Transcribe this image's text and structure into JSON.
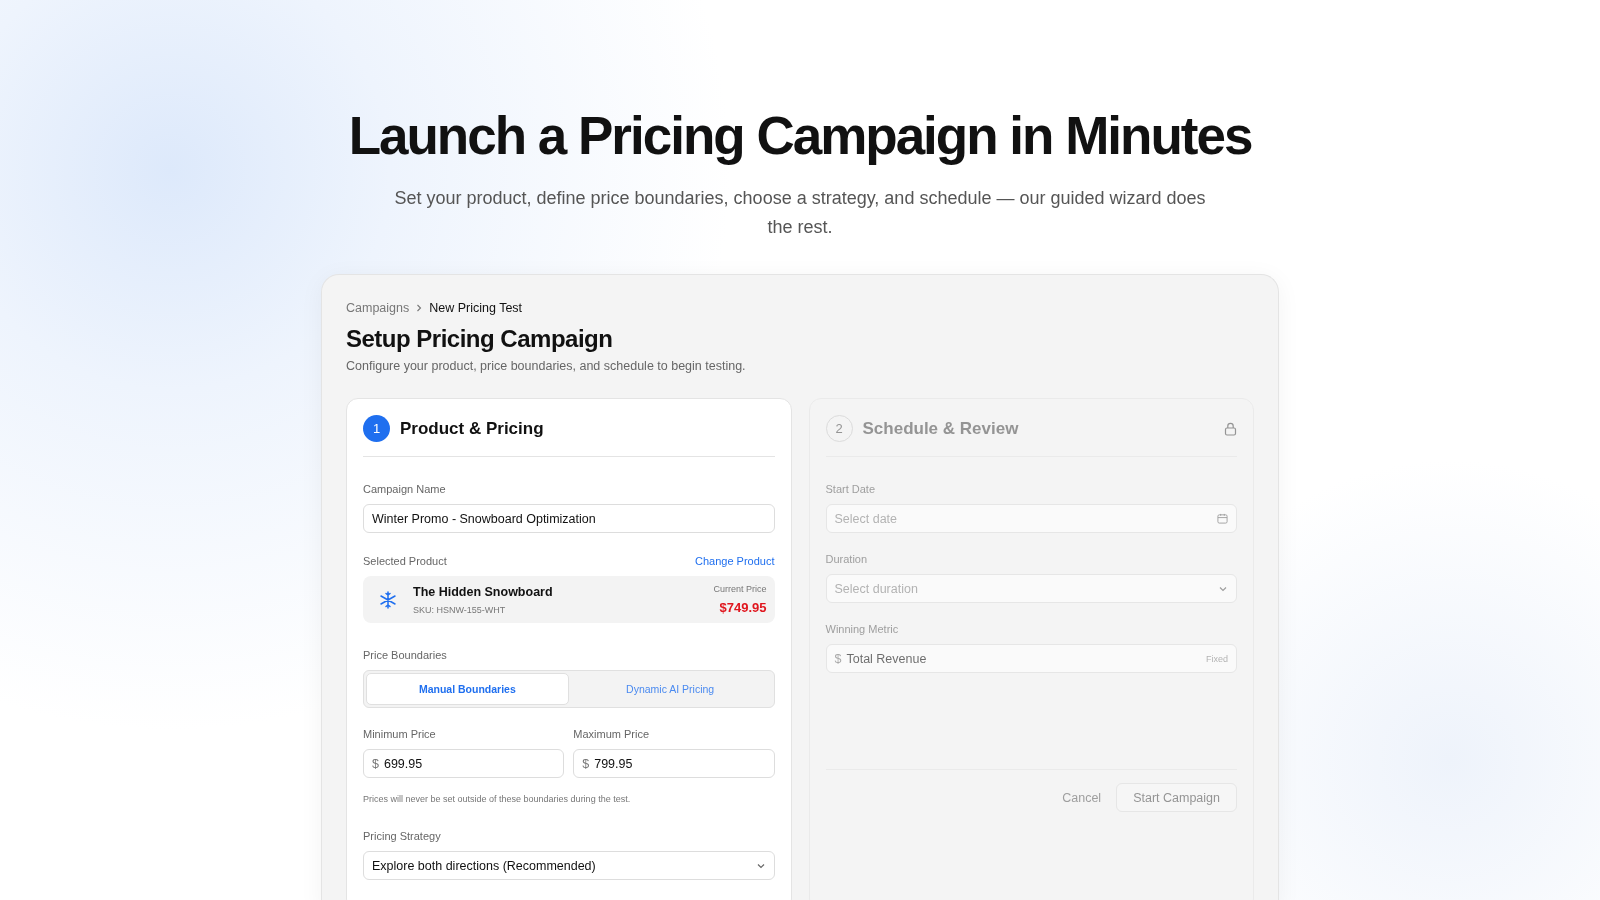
{
  "hero": {
    "title": "Launch a Pricing Campaign in Minutes",
    "subtitle": "Set your product, define price boundaries, choose a strategy, and schedule — our guided wizard does the rest."
  },
  "breadcrumb": [
    {
      "label": "Campaigns",
      "current": false
    },
    {
      "label": "New Pricing Test",
      "current": true
    }
  ],
  "page": {
    "title": "Setup Pricing Campaign",
    "description": "Configure your product, price boundaries, and schedule to begin testing."
  },
  "step1": {
    "number": "1",
    "title": "Product & Pricing",
    "locked": false,
    "campaign_name": {
      "label": "Campaign Name",
      "value": "Winter Promo - Snowboard Optimization"
    },
    "product": {
      "label": "Selected Product",
      "action": "Change Product",
      "name": "The Hidden Snowboard",
      "sku": "SKU: HSNW-155-WHT",
      "price_label": "Current Price",
      "price": "$749.95"
    },
    "boundaries": {
      "label": "Price Boundaries",
      "options": [
        {
          "label": "Manual Boundaries",
          "selected": true
        },
        {
          "label": "Dynamic AI Pricing",
          "selected": false
        }
      ]
    },
    "prices": [
      {
        "label": "Minimum Price",
        "currency": "$",
        "value": "699.95"
      },
      {
        "label": "Maximum Price",
        "currency": "$",
        "value": "799.95"
      }
    ],
    "hint": "Prices will never be set outside of these boundaries during the test.",
    "strategy": {
      "label": "Pricing Strategy",
      "value": "Explore both directions (Recommended)"
    }
  },
  "step2": {
    "number": "2",
    "title": "Schedule & Review",
    "locked": true,
    "fields": [
      {
        "kind": "date",
        "label": "Start Date",
        "placeholder": "Select date"
      },
      {
        "kind": "select",
        "label": "Duration",
        "placeholder": "Select duration"
      },
      {
        "kind": "fixed",
        "label": "Winning Metric",
        "currency": "$",
        "value": "Total Revenue",
        "badge": "Fixed"
      }
    ],
    "cancel": "Cancel",
    "submit": "Start Campaign"
  }
}
